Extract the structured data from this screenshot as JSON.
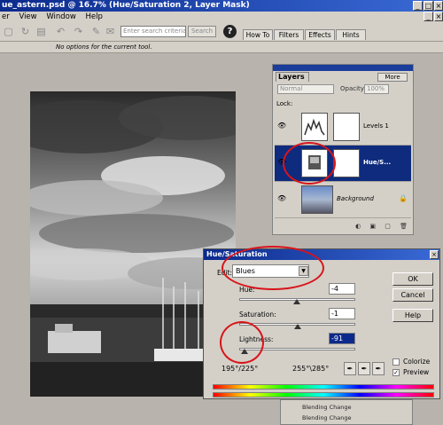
{
  "window": {
    "title": "ue_astern.psd @ 16.7% (Hue/Saturation 2, Layer Mask)"
  },
  "menu": [
    "er",
    "View",
    "Window",
    "Help"
  ],
  "toolbar": {
    "search_placeholder": "Enter search criteria",
    "search_button": "Search",
    "help_icon": "?",
    "tabs": [
      "How To",
      "Filters",
      "Effects",
      "Hints"
    ]
  },
  "options_bar": {
    "message": "No options for the current tool."
  },
  "layers_palette": {
    "tab": "Layers",
    "more_button": "More",
    "blend_mode": "Normal",
    "opacity_label": "Opacity:",
    "opacity_value": "100%",
    "lock_label": "Lock:",
    "layers": [
      {
        "name": "Levels 1",
        "selected": false
      },
      {
        "name": "Hue/S...",
        "selected": true
      },
      {
        "name": "Background",
        "selected": false
      }
    ]
  },
  "hue_saturation": {
    "title": "Hue/Saturation",
    "edit_label": "Edit:",
    "edit_value": "Blues",
    "hue_label": "Hue:",
    "hue_value": "-4",
    "saturation_label": "Saturation:",
    "saturation_value": "-1",
    "lightness_label": "Lightness:",
    "lightness_value": "-91",
    "range_left": "195°/225°",
    "range_right": "255°\\285°",
    "ok": "OK",
    "cancel": "Cancel",
    "help": "Help",
    "colorize_label": "Colorize",
    "colorize_checked": false,
    "preview_label": "Preview",
    "preview_checked": true
  },
  "history": {
    "items": [
      "Blending Change",
      "Blending Change"
    ]
  },
  "colors": {
    "title_bar": "#0b2a8c",
    "selected_layer": "#0e2b7e",
    "annotation_red": "#d8141a"
  }
}
